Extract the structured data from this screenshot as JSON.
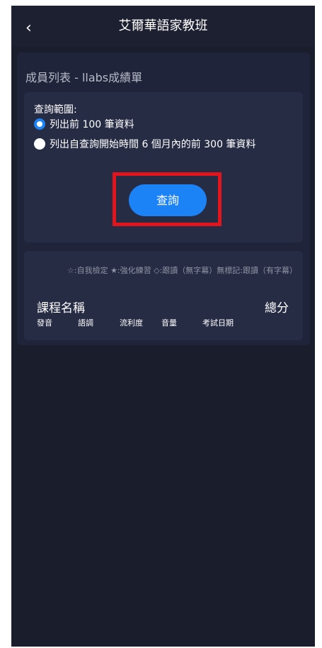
{
  "header": {
    "back_icon": "chevron-left-icon",
    "back_glyph": "‹",
    "title": "艾爾華語家教班"
  },
  "page": {
    "title": "成員列表 - llabs成績單"
  },
  "query": {
    "range_label": "查詢範圍:",
    "options": [
      {
        "label": "列出前 100 筆資料",
        "selected": true
      },
      {
        "label": "列出自查詢開始時間 6 個月內的前 300 筆資料",
        "selected": false
      }
    ],
    "button_label": "查詢"
  },
  "results": {
    "legend": "☆:自我檢定 ★:強化練習 ◇:跟讀（無字幕）無標記:跟讀（有字幕）",
    "course_name_header": "課程名稱",
    "total_score_header": "總分",
    "sub_headers": [
      "發音",
      "語調",
      "流利度",
      "音量",
      "考試日期"
    ]
  },
  "colors": {
    "background": "#1a1d2b",
    "panel": "#20243a",
    "card": "#272c45",
    "accent": "#1c83f7",
    "highlight_frame": "#e3141c"
  }
}
